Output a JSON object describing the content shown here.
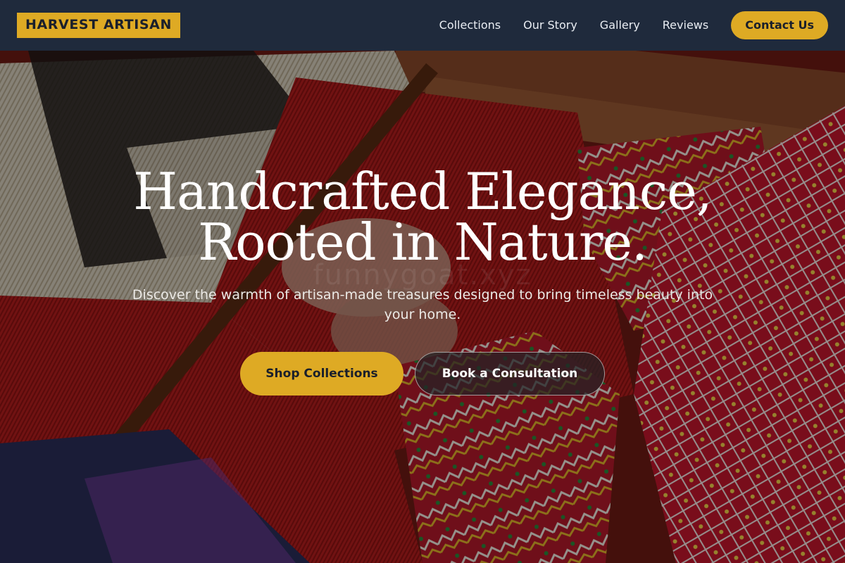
{
  "brand": {
    "name": "HARVEST ARTISAN"
  },
  "nav": {
    "items": [
      {
        "label": "Collections"
      },
      {
        "label": "Our Story"
      },
      {
        "label": "Gallery"
      },
      {
        "label": "Reviews"
      }
    ],
    "cta_label": "Contact Us"
  },
  "hero": {
    "headline_line1": "Handcrafted Elegance,",
    "headline_line2": "Rooted in Nature.",
    "watermark": "funnygoat.xyz",
    "subtitle": "Discover the warmth of artisan-made treasures designed to bring timeless beauty into your home.",
    "primary_button": "Shop Collections",
    "secondary_button": "Book a Consultation"
  },
  "colors": {
    "accent": "#deaa24",
    "navbar_bg": "#1f2a3c",
    "text_light": "#ffffff"
  }
}
